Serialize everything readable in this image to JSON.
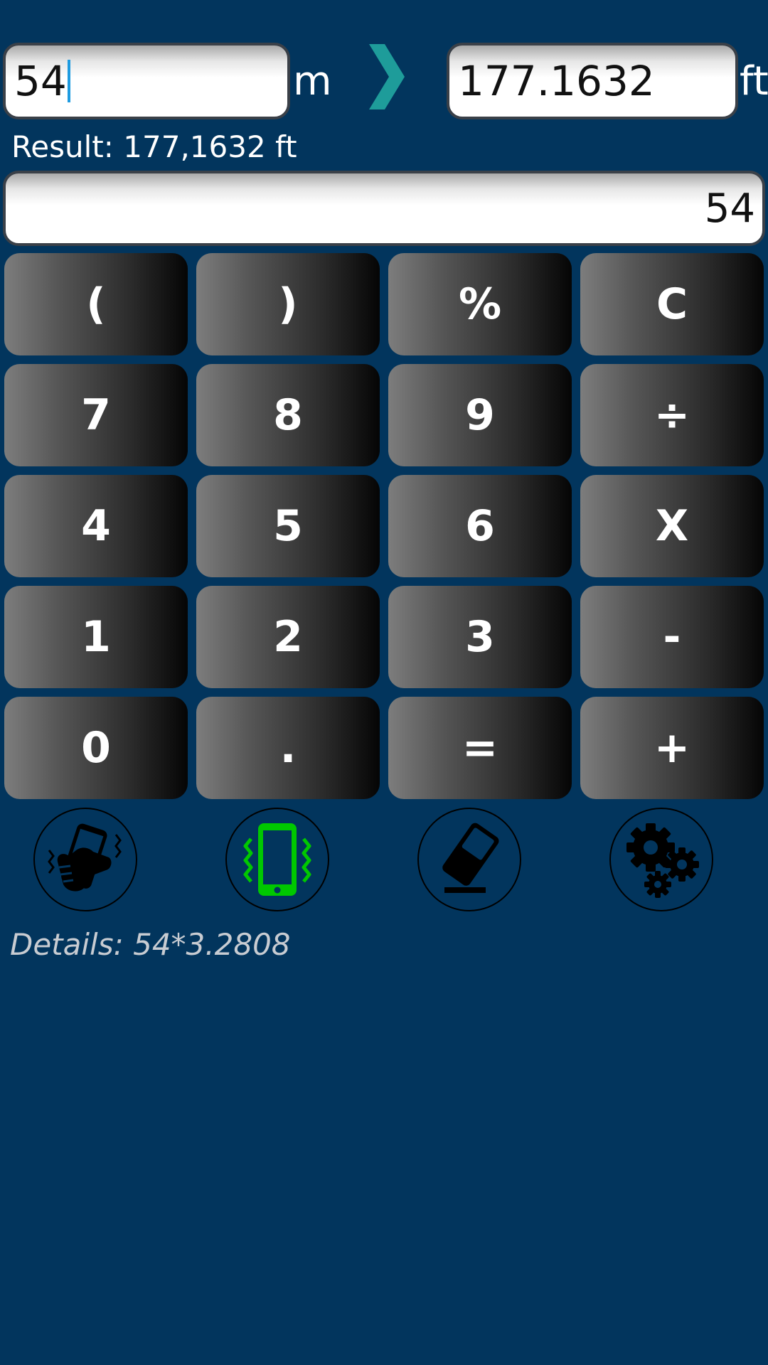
{
  "converter": {
    "from_value": "54",
    "from_unit": "m",
    "to_value": "177.1632",
    "to_unit": "ft",
    "arrow_icon": "chevron-right-icon",
    "arrow_color": "#1e9c9a"
  },
  "result": {
    "text": "Result: 177,1632 ft"
  },
  "display": {
    "value": "54"
  },
  "keypad": {
    "keys": [
      "(",
      ")",
      "%",
      "C",
      "7",
      "8",
      "9",
      "÷",
      "4",
      "5",
      "6",
      "X",
      "1",
      "2",
      "3",
      "-",
      "0",
      ".",
      "=",
      "+"
    ]
  },
  "toolbar": {
    "icons": [
      {
        "name": "shake-phone-icon",
        "color": "#000000"
      },
      {
        "name": "vibrate-phone-icon",
        "color": "#00c800",
        "active": true
      },
      {
        "name": "eraser-icon",
        "color": "#000000"
      },
      {
        "name": "settings-gears-icon",
        "color": "#000000"
      }
    ]
  },
  "details": {
    "text": "Details: 54*3.2808"
  },
  "colors": {
    "background": "#02355d",
    "key_light": "#7d7d7d",
    "key_dark": "#050505",
    "accent_green": "#00c800"
  }
}
